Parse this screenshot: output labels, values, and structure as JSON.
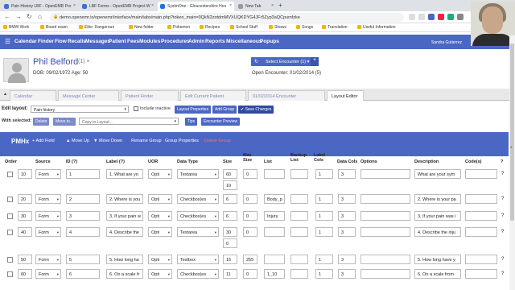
{
  "browser": {
    "tabs": [
      {
        "title": "Pain History LBF - OpenEMR Pro",
        "color": "#3b6fd6"
      },
      {
        "title": "LBF Forms - OpenEMR Project W",
        "color": "#3b6fd6"
      },
      {
        "title": "SystmOne - Gloucestershire Hos",
        "color": "#1a73e8"
      },
      {
        "title": "New Tab",
        "color": "#999999"
      }
    ],
    "url": "demo.openemr.io/openemr/interface/main/tabs/main.php?token_main=0QkN2zotdmMVXUQKDYG4JFr5Zyp3aQCpumfzke",
    "bookmarks": [
      "BMW Work",
      "Board exam",
      "Elite: Dangerous",
      "New folder",
      "Pokemon",
      "Recipes",
      "School Stuff",
      "Shows",
      "Songs",
      "Translation",
      "Useful Information"
    ]
  },
  "nav": {
    "menu": [
      "Calendar",
      "Finder",
      "Flow",
      "Recalls",
      "Messages",
      "Patient",
      "Fees",
      "Modules",
      "Procedures",
      "Admin",
      "Reports",
      "Miscellaneous",
      "Popups"
    ],
    "user": "Sandra Gutierrez"
  },
  "patient": {
    "name": "Phil Belford",
    "count": "(1)",
    "close": "×",
    "dob": "DOB: 09/02/1972 Age: 50",
    "encounter_button": "Select Encounter",
    "encounter_count": "(1)",
    "open_encounter": "Open Encounter: 01/02/2014 (5)"
  },
  "work_tabs": [
    "Calendar",
    "Message Center",
    "Patient Finder",
    "Edit Current Patient",
    "01/02/2014 Encounter",
    "Layout Editor"
  ],
  "editor": {
    "edit_layout_label": "Edit layout:",
    "layout_value": "Pain history",
    "include_inactive": "Include inactive",
    "layout_properties": "Layout Properties",
    "add_group": "Add Group",
    "save_changes": "Save Changes",
    "with_selected": "With selected:",
    "delete": "Delete",
    "move_to": "Move to...",
    "copy_to_layout": "Copy to Layout...",
    "tips": "Tips",
    "encounter_preview": "Encounter Preview"
  },
  "group": {
    "title": "PMHx",
    "actions": [
      "Add Field",
      "Move Up",
      "Move Down",
      "Rename Group",
      "Group Properties",
      "Delete Group"
    ]
  },
  "columns": [
    "Order",
    "Source",
    "ID (?)",
    "Label (?)",
    "UOR",
    "Data Type",
    "Size",
    "Max Size",
    "List",
    "Backup List",
    "Label Cols",
    "Data Cols",
    "Options",
    "Description",
    "Code(s)",
    "?"
  ],
  "rows": [
    {
      "order": "10",
      "source": "Form",
      "id": "1",
      "label": "1. What are yo",
      "uor": "Opti",
      "type": "Textarea",
      "size": "60",
      "size2": "10",
      "max": "0",
      "list": "",
      "lcols": "1",
      "dcols": "3",
      "desc": "What are your sym"
    },
    {
      "order": "20",
      "source": "Form",
      "id": "2",
      "label": "2. Where is you",
      "uor": "Opti",
      "type": "Checkbox(es",
      "size": "6",
      "size2": "",
      "max": "0",
      "list": "Body_p",
      "lcols": "1",
      "dcols": "3",
      "desc": "2. Where is your pa"
    },
    {
      "order": "30",
      "source": "Form",
      "id": "3",
      "label": "3. If your pain w",
      "uor": "Opti",
      "type": "Checkbox(es",
      "size": "6",
      "size2": "",
      "max": "0",
      "list": "Injury",
      "lcols": "1",
      "dcols": "3",
      "desc": "3. If your pain was i"
    },
    {
      "order": "40",
      "source": "Form",
      "id": "4",
      "label": "4. Describe the",
      "uor": "Opti",
      "type": "Textarea",
      "size": "30",
      "size2": "0",
      "max": "0",
      "list": "",
      "lcols": "1",
      "dcols": "3",
      "desc": "4. Describe the inju"
    },
    {
      "order": "50",
      "source": "Form",
      "id": "5",
      "label": "5. How long ha",
      "uor": "Opti",
      "type": "Textbox",
      "size": "15",
      "size2": "",
      "max": "255",
      "list": "",
      "lcols": "1",
      "dcols": "3",
      "desc": "5. How long have y"
    },
    {
      "order": "60",
      "source": "Form",
      "id": "6",
      "label": "6. On a scale fr",
      "uor": "Opti",
      "type": "Checkbox(es",
      "size": "11",
      "size2": "",
      "max": "0",
      "list": "1_10",
      "lcols": "1",
      "dcols": "3",
      "desc": "6. On a scale from"
    }
  ]
}
